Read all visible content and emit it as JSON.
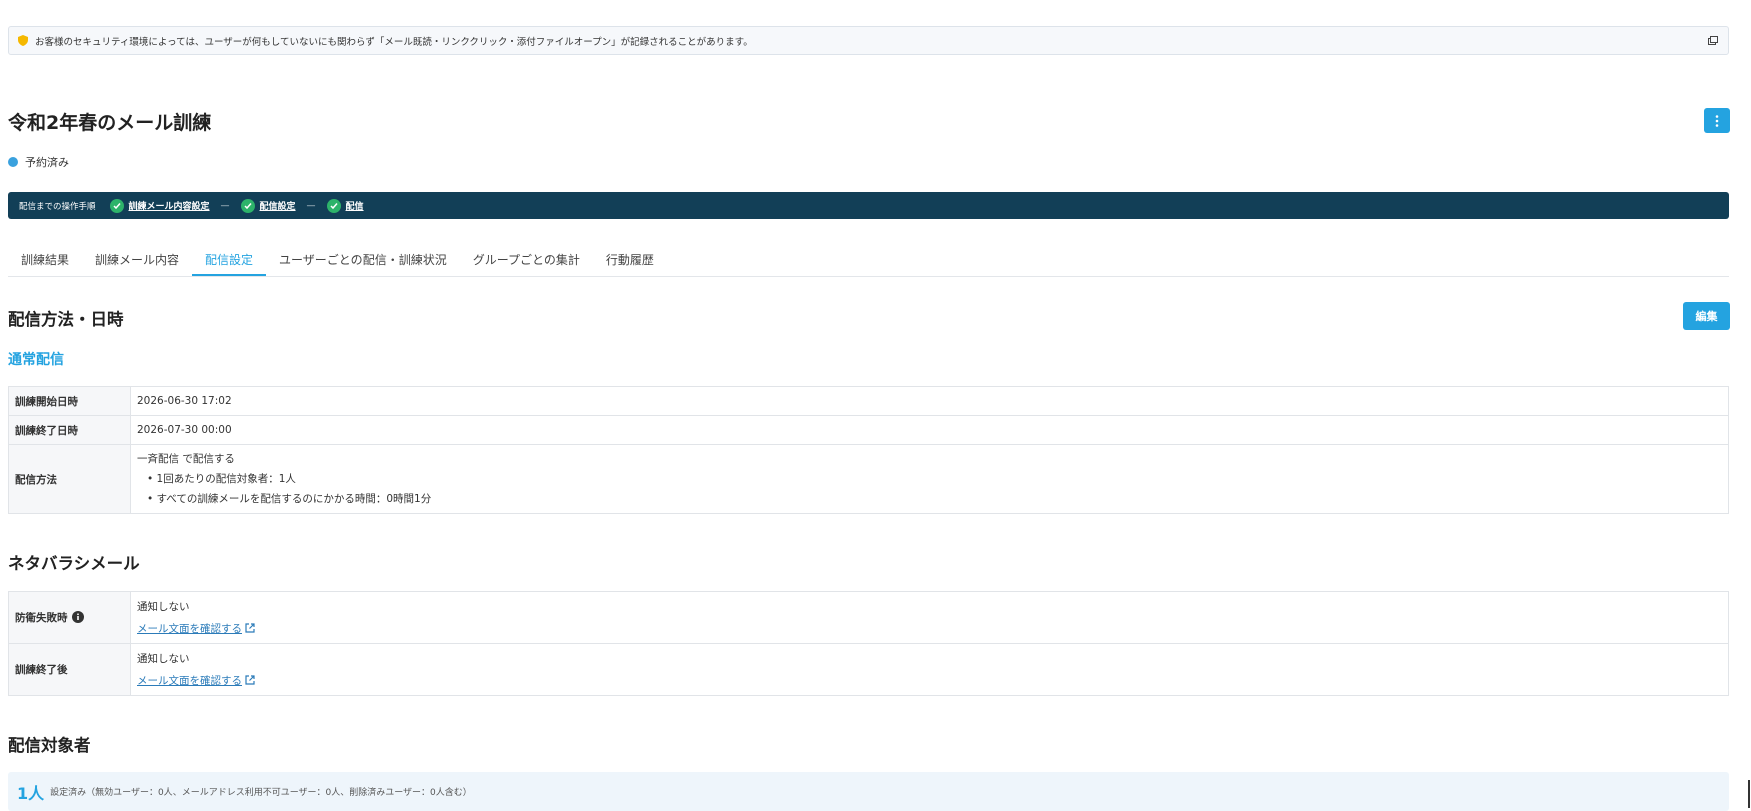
{
  "notice": {
    "text": "お客様のセキュリティ環境によっては、ユーザーが何もしていないにも関わらず「メール既読・リンククリック・添付ファイルオープン」が記録されることがあります。",
    "icon": "shield-icon",
    "accent": "#f5b800"
  },
  "header": {
    "title": "令和2年春のメール訓練",
    "status": "予約済み",
    "status_color": "#3aa1de"
  },
  "steps": {
    "label": "配信までの操作手順",
    "items": [
      "訓練メール内容設定",
      "配信設定",
      "配信"
    ],
    "bar_color": "#123f57",
    "check_color": "#2db36a"
  },
  "tabs": [
    {
      "label": "訓練結果"
    },
    {
      "label": "訓練メール内容"
    },
    {
      "label": "配信設定"
    },
    {
      "label": "ユーザーごとの配信・訓練状況"
    },
    {
      "label": "グループごとの集計"
    },
    {
      "label": "行動履歴"
    }
  ],
  "active_tab": "配信設定",
  "delivery": {
    "section_title": "配信方法・日時",
    "edit_label": "編集",
    "subtitle": "通常配信",
    "rows": [
      {
        "label": "訓練開始日時",
        "value": "2026-06-30 17:02"
      },
      {
        "label": "訓練終了日時",
        "value": "2026-07-30 00:00"
      }
    ],
    "method": {
      "label": "配信方法",
      "line1": "一斉配信 で配信する",
      "line2": "• 1回あたりの配信対象者：1人",
      "line3": "• すべての訓練メールを配信するのにかかる時間：0時間1分"
    }
  },
  "netabare": {
    "section_title": "ネタバラシメール",
    "rows": [
      {
        "label": "防衛失敗時",
        "value": "通知しない",
        "link": "メール文面を確認する"
      },
      {
        "label": "訓練終了後",
        "value": "通知しない",
        "link": "メール文面を確認する"
      }
    ]
  },
  "targets": {
    "section_title": "配信対象者",
    "count": "1人",
    "detail": "設定済み（無効ユーザー：0人、メールアドレス利用不可ユーザー：0人、削除済みユーザー：0人含む）"
  },
  "accent_color": "#24a3e0"
}
